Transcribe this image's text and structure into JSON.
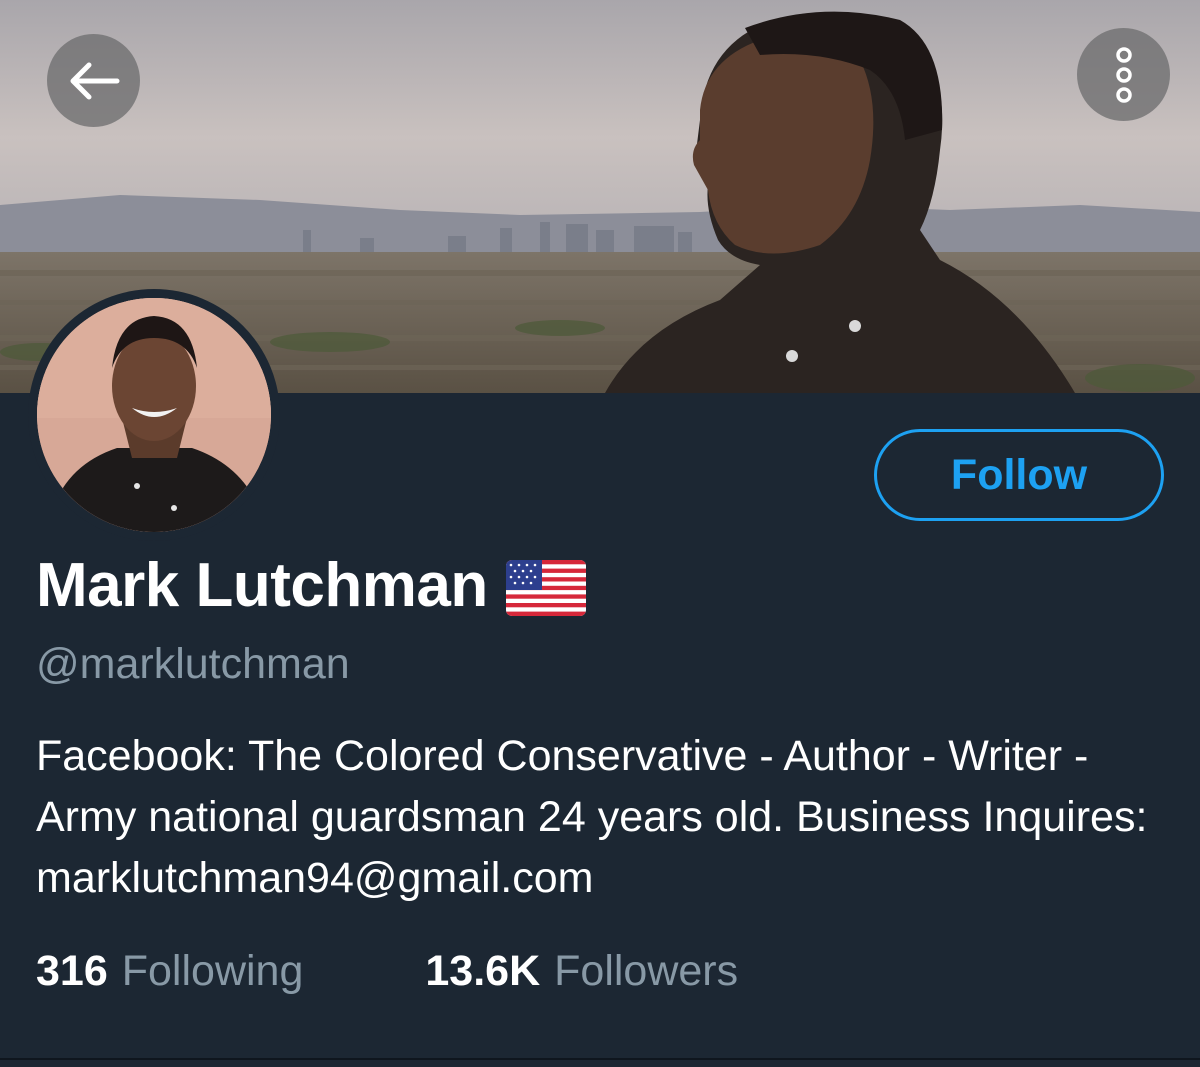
{
  "header": {
    "back_icon": "arrow-left-icon",
    "more_icon": "more-vertical-icon"
  },
  "profile": {
    "name": "Mark Lutchman",
    "name_emoji": "us-flag-icon",
    "handle": "@marklutchman",
    "bio": "Facebook: The Colored Conservative - Author - Writer - Army national guardsman 24 years old. Business Inquires: marklutchman94@gmail.com",
    "follow_label": "Follow"
  },
  "stats": {
    "following_count": "316",
    "following_label": "Following",
    "followers_count": "13.6K",
    "followers_label": "Followers"
  },
  "colors": {
    "background": "#1c2733",
    "accent": "#1da1f2",
    "secondary_text": "#8899a6",
    "primary_text": "#ffffff"
  }
}
